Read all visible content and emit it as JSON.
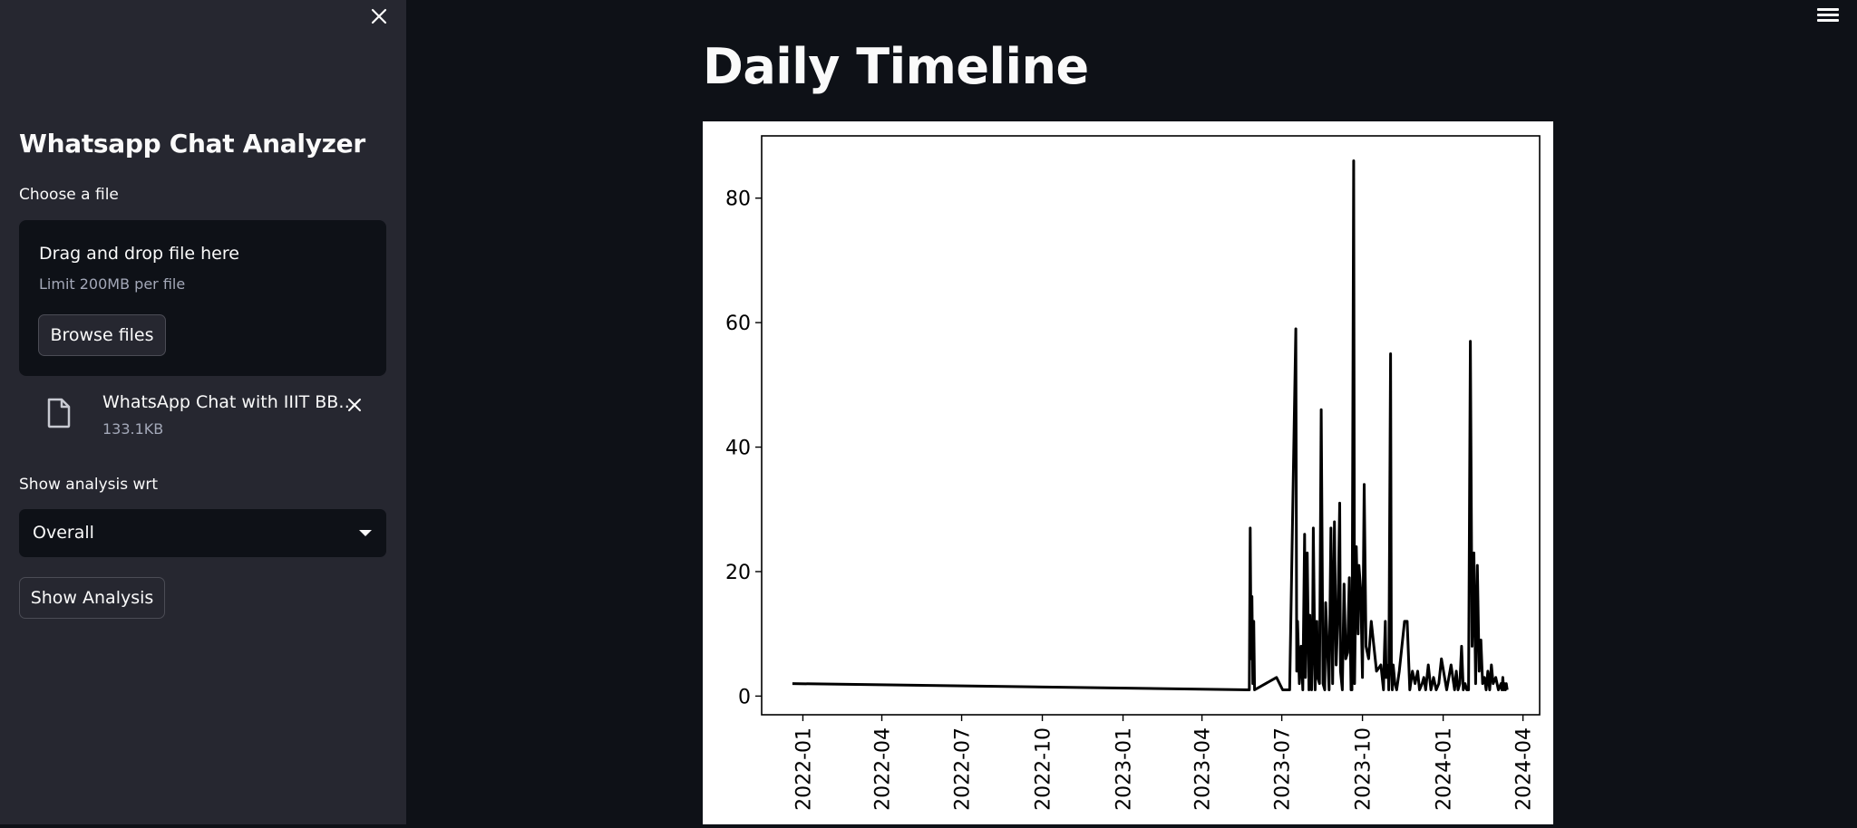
{
  "sidebar": {
    "title": "Whatsapp Chat Analyzer",
    "file_label": "Choose a file",
    "dropzone_main": "Drag and drop file here",
    "dropzone_sub": "Limit 200MB per file",
    "browse_label": "Browse files",
    "uploaded_file": {
      "name": "WhatsApp Chat with IIIT BB…",
      "size": "133.1KB",
      "icon": "file-icon"
    },
    "analysis_label": "Show analysis wrt",
    "select_value": "Overall",
    "show_analysis_label": "Show Analysis",
    "close_icon": "close-icon"
  },
  "header": {
    "menu_icon": "hamburger-menu-icon"
  },
  "main": {
    "title": "Daily Timeline"
  },
  "chart_data": {
    "type": "line",
    "title": "",
    "xlabel": "",
    "ylabel": "",
    "color": "#000000",
    "ylim": [
      -3,
      90
    ],
    "xlim": [
      "2021-11-15",
      "2024-04-20"
    ],
    "yticks": [
      0,
      20,
      40,
      60,
      80
    ],
    "xticks": [
      "2022-01",
      "2022-04",
      "2022-07",
      "2022-10",
      "2023-01",
      "2023-04",
      "2023-07",
      "2023-10",
      "2024-01",
      "2024-04"
    ],
    "xtick_rotation": 90,
    "grid": false,
    "legend": "none",
    "x": [
      "2021-12-20",
      "2023-05-25",
      "2023-05-26",
      "2023-05-27",
      "2023-05-28",
      "2023-05-29",
      "2023-05-30",
      "2023-05-31",
      "2023-06-25",
      "2023-07-02",
      "2023-07-10",
      "2023-07-17",
      "2023-07-18",
      "2023-07-19",
      "2023-07-21",
      "2023-07-23",
      "2023-07-25",
      "2023-07-27",
      "2023-07-28",
      "2023-07-30",
      "2023-08-01",
      "2023-08-02",
      "2023-08-04",
      "2023-08-05",
      "2023-08-06",
      "2023-08-08",
      "2023-08-10",
      "2023-08-11",
      "2023-08-13",
      "2023-08-15",
      "2023-08-17",
      "2023-08-19",
      "2023-08-20",
      "2023-08-22",
      "2023-08-24",
      "2023-08-26",
      "2023-08-28",
      "2023-08-30",
      "2023-09-01",
      "2023-09-03",
      "2023-09-05",
      "2023-09-06",
      "2023-09-08",
      "2023-09-10",
      "2023-09-12",
      "2023-09-14",
      "2023-09-16",
      "2023-09-18",
      "2023-09-19",
      "2023-09-21",
      "2023-09-22",
      "2023-09-24",
      "2023-09-26",
      "2023-09-27",
      "2023-09-29",
      "2023-10-01",
      "2023-10-03",
      "2023-10-05",
      "2023-10-08",
      "2023-10-11",
      "2023-10-14",
      "2023-10-17",
      "2023-10-22",
      "2023-10-25",
      "2023-10-26",
      "2023-10-27",
      "2023-10-28",
      "2023-10-30",
      "2023-10-31",
      "2023-11-02",
      "2023-11-03",
      "2023-11-04",
      "2023-11-05",
      "2023-11-07",
      "2023-11-09",
      "2023-11-12",
      "2023-11-15",
      "2023-11-18",
      "2023-11-21",
      "2023-11-24",
      "2023-11-27",
      "2023-11-30",
      "2023-12-03",
      "2023-12-05",
      "2023-12-08",
      "2023-12-10",
      "2023-12-12",
      "2023-12-15",
      "2023-12-18",
      "2023-12-21",
      "2023-12-24",
      "2023-12-27",
      "2023-12-30",
      "2024-01-05",
      "2024-01-10",
      "2024-01-14",
      "2024-01-16",
      "2024-01-18",
      "2024-01-20",
      "2024-01-22",
      "2024-01-24",
      "2024-01-26",
      "2024-01-28",
      "2024-01-30",
      "2024-02-01",
      "2024-02-03",
      "2024-02-05",
      "2024-02-07",
      "2024-02-09",
      "2024-02-11",
      "2024-02-13",
      "2024-02-15",
      "2024-02-17",
      "2024-02-19",
      "2024-02-21",
      "2024-02-23",
      "2024-02-25",
      "2024-02-27",
      "2024-03-01",
      "2024-03-04",
      "2024-03-07",
      "2024-03-08",
      "2024-03-09",
      "2024-03-10",
      "2024-03-11",
      "2024-03-12",
      "2024-03-13",
      "2024-03-14",
      "2024-03-15",
      "2024-03-16"
    ],
    "y": [
      2,
      1,
      27,
      6,
      16,
      2,
      12,
      1,
      3,
      1,
      1,
      59,
      4,
      12,
      2,
      8,
      1,
      26,
      3,
      23,
      1,
      13,
      1,
      8,
      27,
      1,
      12,
      3,
      2,
      46,
      2,
      1,
      15,
      8,
      1,
      27,
      2,
      28,
      5,
      13,
      31,
      4,
      1,
      18,
      6,
      7,
      19,
      1,
      1,
      86,
      2,
      24,
      10,
      21,
      17,
      3,
      34,
      8,
      6,
      12,
      8,
      4,
      5,
      1,
      7,
      12,
      3,
      5,
      1,
      55,
      4,
      1,
      5,
      2,
      1,
      4,
      8,
      12,
      12,
      1,
      4,
      2,
      4,
      1,
      2,
      3,
      1,
      5,
      1,
      3,
      1,
      2,
      6,
      1,
      5,
      1,
      4,
      1,
      2,
      8,
      1,
      2,
      1,
      1,
      57,
      8,
      23,
      2,
      21,
      4,
      9,
      2,
      3,
      1,
      4,
      1,
      5,
      2,
      3,
      1,
      2,
      1,
      3,
      1,
      2,
      1,
      2,
      1
    ]
  }
}
